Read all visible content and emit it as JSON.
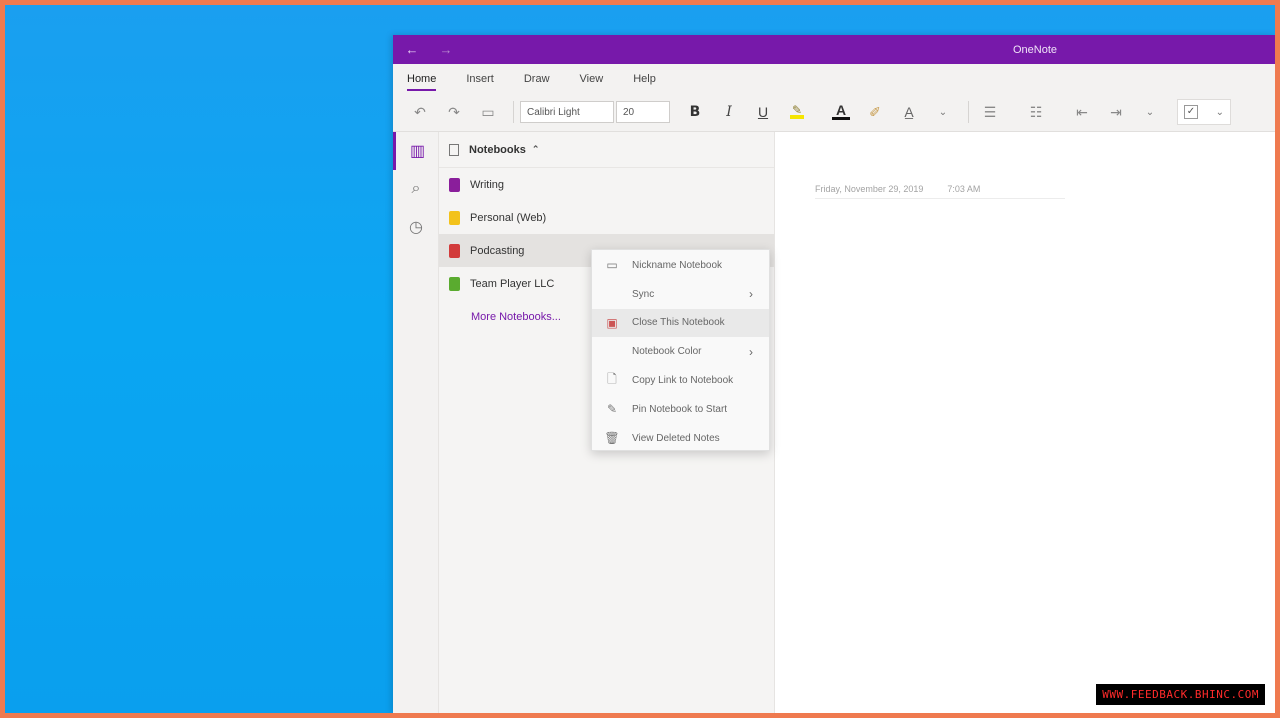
{
  "window": {
    "app_title": "OneNote"
  },
  "titlebar": {
    "back_icon": "←",
    "forward_icon": "→"
  },
  "ribbon": {
    "tabs": [
      {
        "label": "Home",
        "active": true
      },
      {
        "label": "Insert"
      },
      {
        "label": "Draw"
      },
      {
        "label": "View"
      },
      {
        "label": "Help"
      }
    ],
    "font_name": "Calibri Light",
    "font_size": "20",
    "bold": "B",
    "italic": "I",
    "underline": "U",
    "font_color_letter": "A"
  },
  "notebooks": {
    "header": "Notebooks",
    "items": [
      {
        "label": "Writing",
        "color": "#8a1e9b"
      },
      {
        "label": "Personal (Web)",
        "color": "#f3c21b"
      },
      {
        "label": "Podcasting",
        "color": "#d23b3b",
        "selected": true
      },
      {
        "label": "Team Player LLC",
        "color": "#5aab2f"
      }
    ],
    "more": "More Notebooks..."
  },
  "page": {
    "date": "Friday, November 29, 2019",
    "time": "7:03 AM"
  },
  "context_menu": {
    "items": [
      {
        "label": "Nickname Notebook",
        "icon": "folder-icon"
      },
      {
        "label": "Sync",
        "submenu": true
      },
      {
        "label": "Close This Notebook",
        "icon": "close-notebook-icon",
        "hover": true
      },
      {
        "label": "Notebook Color",
        "submenu": true
      },
      {
        "label": "Copy Link to Notebook",
        "icon": "link-doc-icon"
      },
      {
        "label": "Pin Notebook to Start",
        "icon": "pin-icon"
      },
      {
        "label": "View Deleted Notes",
        "icon": "trash-icon"
      }
    ]
  },
  "watermark": "WWW.FEEDBACK.BHINC.COM",
  "colors": {
    "accent": "#7719aa",
    "desktop": "#0aa6f2",
    "frame": "#ef7a4f"
  }
}
